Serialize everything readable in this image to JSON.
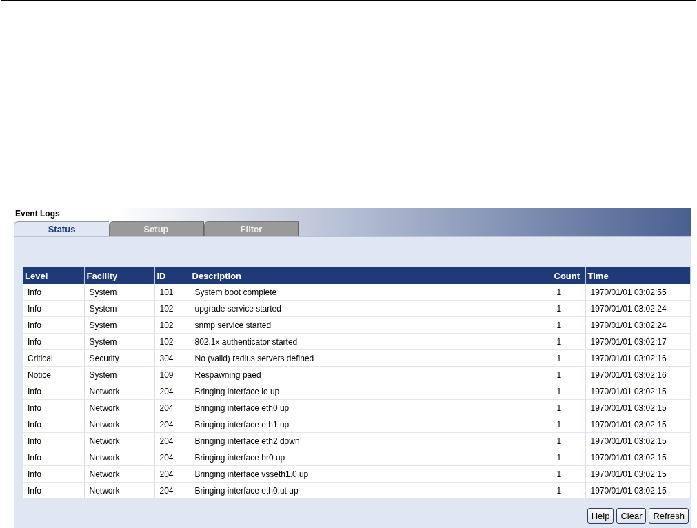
{
  "page": {
    "title": "Event Logs"
  },
  "tabs": [
    {
      "label": "Status",
      "selected": true
    },
    {
      "label": "Setup",
      "selected": false
    },
    {
      "label": "Filter",
      "selected": false
    }
  ],
  "table": {
    "columns": [
      "Level",
      "Facility",
      "ID",
      "Description",
      "Count",
      "Time"
    ],
    "rows": [
      [
        "Info",
        "System",
        "101",
        "System boot complete",
        "1",
        "1970/01/01 03:02:55"
      ],
      [
        "Info",
        "System",
        "102",
        "upgrade service started",
        "1",
        "1970/01/01 03:02:24"
      ],
      [
        "Info",
        "System",
        "102",
        "snmp service started",
        "1",
        "1970/01/01 03:02:24"
      ],
      [
        "Info",
        "System",
        "102",
        "802.1x authenticator started",
        "1",
        "1970/01/01 03:02:17"
      ],
      [
        "Critical",
        "Security",
        "304",
        "No (valid) radius servers defined",
        "1",
        "1970/01/01 03:02:16"
      ],
      [
        "Notice",
        "System",
        "109",
        "Respawning paed",
        "1",
        "1970/01/01 03:02:16"
      ],
      [
        "Info",
        "Network",
        "204",
        "Bringing interface lo up",
        "1",
        "1970/01/01 03:02:15"
      ],
      [
        "Info",
        "Network",
        "204",
        "Bringing interface eth0 up",
        "1",
        "1970/01/01 03:02:15"
      ],
      [
        "Info",
        "Network",
        "204",
        "Bringing interface eth1 up",
        "1",
        "1970/01/01 03:02:15"
      ],
      [
        "Info",
        "Network",
        "204",
        "Bringing interface eth2 down",
        "1",
        "1970/01/01 03:02:15"
      ],
      [
        "Info",
        "Network",
        "204",
        "Bringing interface br0 up",
        "1",
        "1970/01/01 03:02:15"
      ],
      [
        "Info",
        "Network",
        "204",
        "Bringing interface vsseth1.0 up",
        "1",
        "1970/01/01 03:02:15"
      ],
      [
        "Info",
        "Network",
        "204",
        "Bringing interface eth0.ut up",
        "1",
        "1970/01/01 03:02:15"
      ]
    ]
  },
  "buttons": [
    "Help",
    "Clear",
    "Refresh"
  ]
}
